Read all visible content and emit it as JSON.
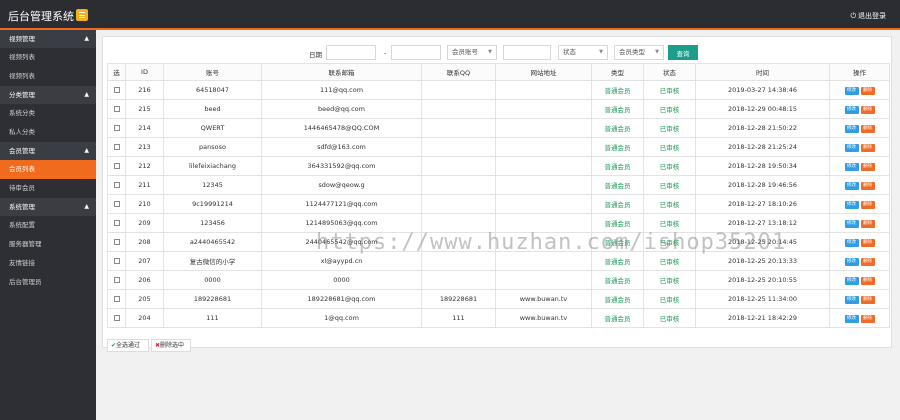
{
  "header": {
    "title": "后台管理系统",
    "logout_label": "退出登录"
  },
  "sidebar": {
    "groups": [
      {
        "title": "视频管理",
        "items": [
          "视频列表",
          "视频列表"
        ]
      },
      {
        "title": "分类管理",
        "items": [
          "系统分类",
          "私人分类"
        ]
      },
      {
        "title": "会员管理",
        "items": [
          "会员列表",
          "待审会员"
        ]
      },
      {
        "title": "系统管理",
        "items": [
          "系统配置",
          "服务器管理",
          "友情链接",
          "后台管理员"
        ]
      }
    ],
    "active_item": "会员列表"
  },
  "filter": {
    "date_label": "日期",
    "range_sep": "-",
    "account_select": "会员账号",
    "status_select": "状态",
    "type_select": "会员类型",
    "search_button": "查询"
  },
  "table": {
    "headers": [
      "选",
      "ID",
      "账号",
      "联系邮箱",
      "联系QQ",
      "网站地址",
      "类型",
      "状态",
      "时间",
      "操作"
    ],
    "edit_label": "修改",
    "delete_label": "删除",
    "rows": [
      [
        "216",
        "64518047",
        "111@qq.com",
        "",
        "",
        "普通会员",
        "已审核",
        "2019-03-27 14:38:46"
      ],
      [
        "215",
        "beed",
        "beed@qq.com",
        "",
        "",
        "普通会员",
        "已审核",
        "2018-12-29 00:48:15"
      ],
      [
        "214",
        "QWERT",
        "1446465478@QQ.COM",
        "",
        "",
        "普通会员",
        "已审核",
        "2018-12-28 21:50:22"
      ],
      [
        "213",
        "pansoso",
        "sdfd@163.com",
        "",
        "",
        "普通会员",
        "已审核",
        "2018-12-28 21:25:24"
      ],
      [
        "212",
        "lilefeixiachang",
        "364331592@qq.com",
        "",
        "",
        "普通会员",
        "已审核",
        "2018-12-28 19:50:34"
      ],
      [
        "211",
        "12345",
        "sdow@qeow.g",
        "",
        "",
        "普通会员",
        "已审核",
        "2018-12-28 19:46:56"
      ],
      [
        "210",
        "9c19991214",
        "1124477121@qq.com",
        "",
        "",
        "普通会员",
        "已审核",
        "2018-12-27 18:10:26"
      ],
      [
        "209",
        "123456",
        "1214895063@qq.com",
        "",
        "",
        "普通会员",
        "已审核",
        "2018-12-27 13:18:12"
      ],
      [
        "208",
        "a2440465542",
        "2440465542@qq.com",
        "",
        "",
        "普通会员",
        "已审核",
        "2018-12-25 20:14:45"
      ],
      [
        "207",
        "复古微信的小学",
        "xl@ayypd.cn",
        "",
        "",
        "普通会员",
        "已审核",
        "2018-12-25 20:13:33"
      ],
      [
        "206",
        "0000",
        "0000",
        "",
        "",
        "普通会员",
        "已审核",
        "2018-12-25 20:10:55"
      ],
      [
        "205",
        "189228681",
        "189228681@qq.com",
        "189228681",
        "www.buwan.tv",
        "普通会员",
        "已审核",
        "2018-12-25 11:34:00"
      ],
      [
        "204",
        "111",
        "1@qq.com",
        "111",
        "www.buwan.tv",
        "普通会员",
        "已审核",
        "2018-12-21 18:42:29"
      ]
    ]
  },
  "bulk": {
    "approve_label": "全选通过",
    "delete_label": "删除选中"
  },
  "watermark": "https://www.huzhan.com/ishop35201",
  "colors": {
    "accent": "#f16b1f",
    "sidebar_bg": "#2d2f35",
    "search_button": "#1a9d8b",
    "edit": "#2f9ee4",
    "delete": "#f06a28"
  }
}
